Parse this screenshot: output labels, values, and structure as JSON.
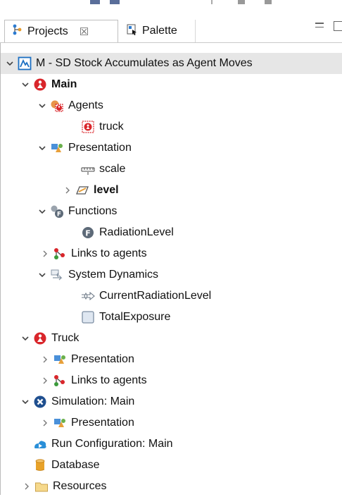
{
  "tabs": {
    "projects_label": "Projects",
    "palette_label": "Palette"
  },
  "tree": {
    "rows": [
      {
        "label": "M - SD Stock Accumulates as Agent Moves"
      },
      {
        "label": "Main"
      },
      {
        "label": "Agents"
      },
      {
        "label": "truck"
      },
      {
        "label": "Presentation"
      },
      {
        "label": "scale"
      },
      {
        "label": "level"
      },
      {
        "label": "Functions"
      },
      {
        "label": "RadiationLevel"
      },
      {
        "label": "Links to agents"
      },
      {
        "label": "System Dynamics"
      },
      {
        "label": "CurrentRadiationLevel"
      },
      {
        "label": "TotalExposure"
      },
      {
        "label": "Truck"
      },
      {
        "label": "Presentation"
      },
      {
        "label": "Links to agents"
      },
      {
        "label": "Simulation: Main"
      },
      {
        "label": "Presentation"
      },
      {
        "label": "Run Configuration: Main"
      },
      {
        "label": "Database"
      },
      {
        "label": "Resources"
      }
    ]
  }
}
